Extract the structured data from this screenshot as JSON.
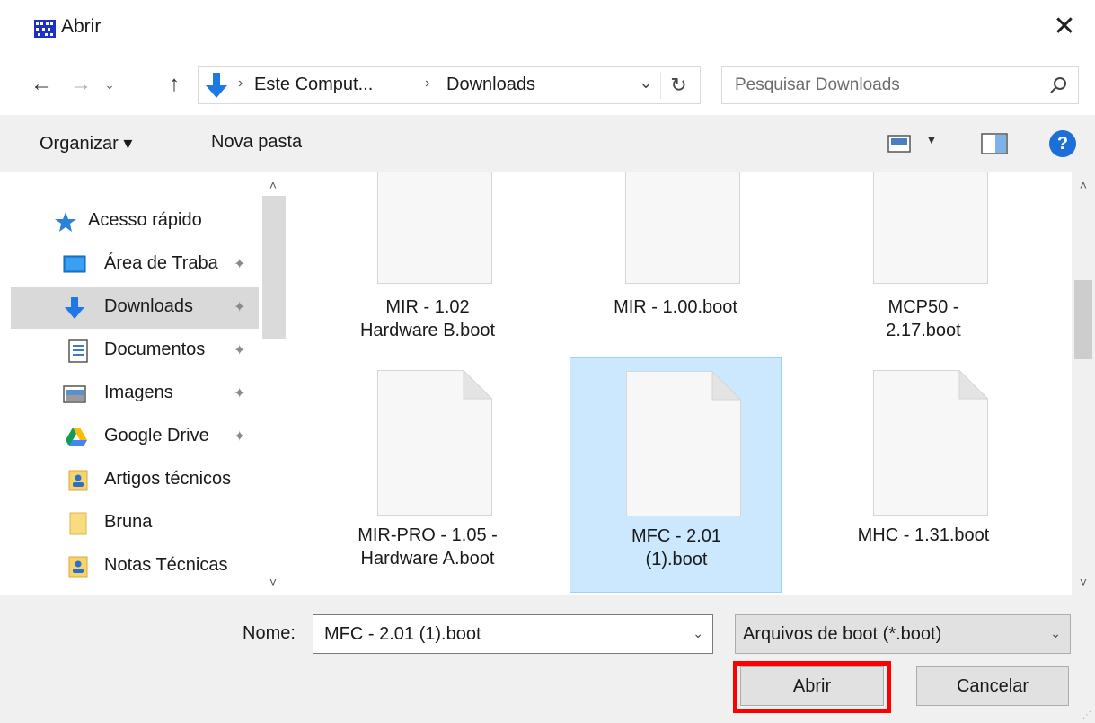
{
  "window": {
    "title": "Abrir",
    "close_glyph": "✕"
  },
  "address": {
    "crumbs": [
      "Este Comput...",
      "Downloads"
    ],
    "search_placeholder": "Pesquisar Downloads"
  },
  "toolbar": {
    "organize_label": "Organizar ▾",
    "new_folder_label": "Nova pasta",
    "help_glyph": "?"
  },
  "sidebar": {
    "items": [
      {
        "label": "Acesso rápido",
        "icon": "star-icon",
        "pinned": false,
        "active": false
      },
      {
        "label": "Área de Traba",
        "icon": "desktop-icon",
        "pinned": true,
        "active": false
      },
      {
        "label": "Downloads",
        "icon": "download-arrow-icon",
        "pinned": true,
        "active": true
      },
      {
        "label": "Documentos",
        "icon": "document-icon",
        "pinned": true,
        "active": false
      },
      {
        "label": "Imagens",
        "icon": "image-icon",
        "pinned": true,
        "active": false
      },
      {
        "label": "Google Drive",
        "icon": "google-drive-icon",
        "pinned": true,
        "active": false
      },
      {
        "label": "Artigos técnicos",
        "icon": "folder-user-icon",
        "pinned": false,
        "active": false
      },
      {
        "label": "Bruna",
        "icon": "folder-icon",
        "pinned": false,
        "active": false
      },
      {
        "label": "Notas Técnicas",
        "icon": "folder-user-icon",
        "pinned": false,
        "active": false
      }
    ]
  },
  "files": [
    {
      "name_line1": "MIR - 1.02",
      "name_line2": "Hardware B.boot",
      "selected": false
    },
    {
      "name_line1": "MIR - 1.00.boot",
      "name_line2": "",
      "selected": false
    },
    {
      "name_line1": "MCP50 -",
      "name_line2": "2.17.boot",
      "selected": false
    },
    {
      "name_line1": "MIR-PRO - 1.05 -",
      "name_line2": "Hardware A.boot",
      "selected": false
    },
    {
      "name_line1": "MFC - 2.01",
      "name_line2": "(1).boot",
      "selected": true
    },
    {
      "name_line1": "MHC - 1.31.boot",
      "name_line2": "",
      "selected": false
    }
  ],
  "bottom": {
    "name_label": "Nome:",
    "name_value": "MFC - 2.01 (1).boot",
    "file_type": "Arquivos de boot (*.boot)",
    "open_label": "Abrir",
    "cancel_label": "Cancelar"
  },
  "colors": {
    "selection_bg": "#cce8ff",
    "selection_border": "#99d1ff",
    "highlight": "#ff0000",
    "accent": "#1c6fd6"
  }
}
